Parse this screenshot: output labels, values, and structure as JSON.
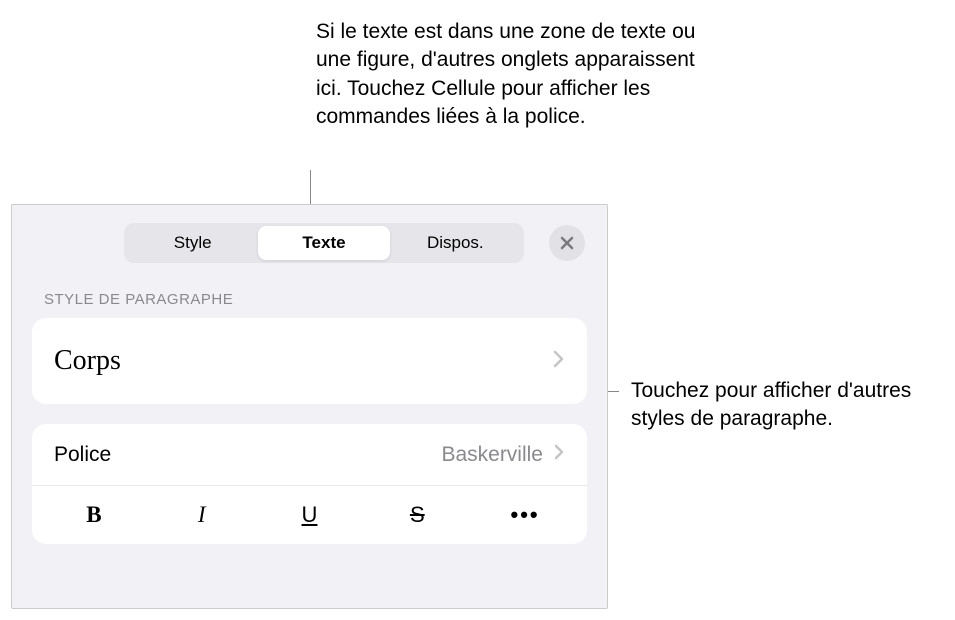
{
  "callouts": {
    "top": "Si le texte est dans une zone de texte ou une figure, d'autres onglets apparaissent ici. Touchez Cellule pour afficher les commandes liées à la police.",
    "right": "Touchez pour afficher d'autres styles de paragraphe."
  },
  "tabs": {
    "style": "Style",
    "texte": "Texte",
    "dispos": "Dispos."
  },
  "section": {
    "paragraphStyleLabel": "STYLE DE PARAGRAPHE"
  },
  "paragraphStyle": {
    "current": "Corps"
  },
  "font": {
    "label": "Police",
    "value": "Baskerville"
  },
  "styleButtons": {
    "bold": "B",
    "italic": "I",
    "underline": "U",
    "strike": "S",
    "more": "•••"
  }
}
